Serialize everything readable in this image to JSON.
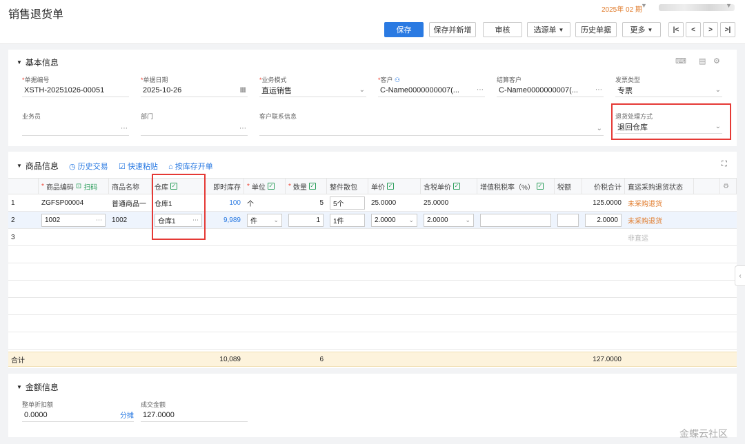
{
  "title": "销售退货单",
  "period": "2025年 02 期",
  "toolbar": {
    "save": "保存",
    "save_new": "保存并新增",
    "audit": "审核",
    "select_source": "选源单",
    "history": "历史单据",
    "more": "更多",
    "nav_first": "|<",
    "nav_prev": "<",
    "nav_next": ">",
    "nav_last": ">|"
  },
  "basic": {
    "title": "基本信息",
    "fields": {
      "doc_no": {
        "label": "单据编号",
        "value": "XSTH-20251026-00051"
      },
      "doc_date": {
        "label": "单据日期",
        "value": "2025-10-26"
      },
      "biz_mode": {
        "label": "业务模式",
        "value": "直运销售"
      },
      "customer": {
        "label": "客户",
        "value": "C-Name0000000007(..."
      },
      "settle_customer": {
        "label": "结算客户",
        "value": "C-Name0000000007(..."
      },
      "invoice_type": {
        "label": "发票类型",
        "value": "专票"
      },
      "salesman": {
        "label": "业务员",
        "value": ""
      },
      "dept": {
        "label": "部门",
        "value": ""
      },
      "contact": {
        "label": "客户联系信息",
        "value": ""
      },
      "return_method": {
        "label": "退货处理方式",
        "value": "退回仓库"
      }
    }
  },
  "goods": {
    "title": "商品信息",
    "links": {
      "history": "历史交易",
      "paste": "快速粘贴",
      "by_stock": "按库存开单"
    },
    "scan": "扫码",
    "headers": {
      "code": "商品编码",
      "name": "商品名称",
      "warehouse": "仓库",
      "stock": "即时库存",
      "unit": "单位",
      "qty": "数量",
      "pack": "整件散包",
      "price": "单价",
      "tax_price": "含税单价",
      "tax_rate": "增值税税率（%）",
      "tax": "税额",
      "total": "价税合计",
      "status": "直运采购退货状态"
    },
    "rows": [
      {
        "no": "1",
        "code": "ZGFSP00004",
        "name": "普通商品一",
        "warehouse": "仓库1",
        "stock": "100",
        "unit": "个",
        "qty": "5",
        "pack": "5个",
        "price": "25.0000",
        "tax_price": "25.0000",
        "tax_rate": "",
        "tax": "",
        "total": "125.0000",
        "status": "未采购退货"
      },
      {
        "no": "2",
        "code": "1002",
        "name": "1002",
        "warehouse": "仓库1",
        "stock": "9,989",
        "unit": "件",
        "qty": "1",
        "pack": "1件",
        "price": "2.0000",
        "tax_price": "2.0000",
        "tax_rate": "",
        "tax": "",
        "total": "2.0000",
        "status": "未采购退货"
      },
      {
        "no": "3",
        "status": "非直运"
      }
    ],
    "totals": {
      "label": "合计",
      "stock": "10,089",
      "qty": "6",
      "total": "127.0000"
    }
  },
  "amount": {
    "title": "金额信息",
    "discount": {
      "label": "整单折扣额",
      "value": "0.0000",
      "action": "分摊"
    },
    "deal": {
      "label": "成交金额",
      "value": "127.0000"
    }
  },
  "watermark": "金蝶云社区",
  "colors": {
    "primary": "#2a7ae2",
    "highlight": "#e53935",
    "status_orange": "#e07a2a",
    "total_bg": "#fdf3dc"
  }
}
